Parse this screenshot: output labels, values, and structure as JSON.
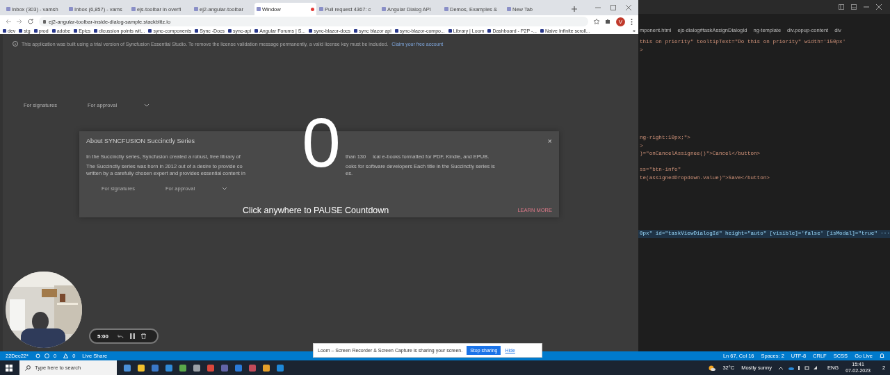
{
  "browser": {
    "tabs": [
      {
        "title": "Inbox (303) - vamsh",
        "selected": false,
        "recording": false
      },
      {
        "title": "Inbox (6,857) - vams",
        "selected": false,
        "recording": false
      },
      {
        "title": "ejs-toolbar in overfl",
        "selected": false,
        "recording": false
      },
      {
        "title": "ej2-angular-toolbar",
        "selected": false,
        "recording": false
      },
      {
        "title": "Window",
        "selected": true,
        "recording": true
      },
      {
        "title": "Pull request 4367: c",
        "selected": false,
        "recording": false
      },
      {
        "title": "Angular Dialog API",
        "selected": false,
        "recording": false
      },
      {
        "title": "Demos, Examples &",
        "selected": false,
        "recording": false
      },
      {
        "title": "New Tab",
        "selected": false,
        "recording": false
      }
    ],
    "address": "ej2-angular-toolbar-inside-dialog-sample.stackblitz.io",
    "profile_initial": "V",
    "bookmarks": [
      "dev",
      "stg",
      "prod",
      "adobe",
      "Epics",
      "dicussion points wit...",
      "sync-components",
      "Sync -Docs",
      "sync-api",
      "Angular Forums | S...",
      "sync-blazor-docs",
      "sync blazor api",
      "sync-blazor-compo...",
      "Library | Loom",
      "Dashboard - P2P -...",
      "Naive Infinite scroll..."
    ],
    "bookmarks_more": "»"
  },
  "page": {
    "license_notice": "This application was built using a trial version of Syncfusion Essential Studio. To remove the license validation message permanently, a valid license key must be included.",
    "license_link": "Claim your free account",
    "filters": [
      "For signatures",
      "For approval"
    ],
    "dialog": {
      "title": "About SYNCFUSION Succinctly Series",
      "close": "×",
      "lines": [
        [
          "In the Succinctly series, Syncfusion created a robust, free library of",
          "than 130",
          "ical e-books formatted for PDF, Kindle, and EPUB."
        ],
        [
          "The Succinctly series was born in 2012 out of a desire to provide co",
          "ooks for software developers Each title in the Succinctly series is"
        ],
        [
          "written by a carefully chosen expert and provides essential content in",
          "es."
        ]
      ],
      "filters": [
        "For signatures",
        "For approval"
      ],
      "action": "LEARN MORE"
    }
  },
  "recording_overlay": {
    "countdown": "0",
    "hint": "Click anywhere to PAUSE Countdown",
    "timer": "5:00"
  },
  "loom_bar": {
    "message": "Loom – Screen Recorder & Screen Capture is sharing your screen.",
    "button": "Stop sharing",
    "link": "Hide"
  },
  "editor": {
    "breadcrumbs": [
      "mponent.html",
      "ejs-dialog#taskAssignDialogId",
      "ng-template",
      "div.popup-content",
      "div"
    ],
    "lines": [
      {
        "kind": "code",
        "text": "this on priority\" tooltipText=\"Do this on priority\" width='150px'",
        "selected": false
      },
      {
        "kind": "code",
        "text": ">",
        "selected": false
      },
      {
        "kind": "blank",
        "selected": false
      },
      {
        "kind": "blank",
        "selected": false
      },
      {
        "kind": "blank",
        "selected": false
      },
      {
        "kind": "blank",
        "selected": false
      },
      {
        "kind": "blank",
        "selected": false
      },
      {
        "kind": "blank",
        "selected": false
      },
      {
        "kind": "blank",
        "selected": false
      },
      {
        "kind": "blank",
        "selected": false
      },
      {
        "kind": "blank",
        "selected": false
      },
      {
        "kind": "blank",
        "selected": false
      },
      {
        "kind": "code",
        "text": "ng-right:10px;\">",
        "selected": false
      },
      {
        "kind": "code",
        "text": ">",
        "selected": false
      },
      {
        "kind": "code",
        "text": ")=\"onCancelAssignee()\">Cancel</button>",
        "selected": false
      },
      {
        "kind": "blank",
        "selected": false
      },
      {
        "kind": "code",
        "text": "ss=\"btn-info\"",
        "selected": false
      },
      {
        "kind": "code",
        "text": "te(assignedDropdown.value)\">Save</button>",
        "selected": false
      },
      {
        "kind": "blank",
        "selected": false
      },
      {
        "kind": "blank",
        "selected": false
      },
      {
        "kind": "blank",
        "selected": false
      },
      {
        "kind": "blank",
        "selected": false
      },
      {
        "kind": "blank",
        "selected": false
      },
      {
        "kind": "blank",
        "selected": false
      },
      {
        "kind": "code",
        "text": "0px\" id=\"taskViewDialogId\" height=\"auto\" [visible]='false' [isModal]=\"true\" ···",
        "selected": true
      }
    ]
  },
  "status_bar": {
    "branch": "22Dec22*",
    "errors": "0",
    "warnings": "0",
    "live_share": "Live Share",
    "right": [
      "Ln 67, Col 16",
      "Spaces: 2",
      "UTF-8",
      "CRLF",
      "SCSS"
    ],
    "go_live": "Go Live"
  },
  "taskbar": {
    "search_placeholder": "Type here to search",
    "temperature": "32°C",
    "weather": "Mostly sunny",
    "language": "ENG",
    "time": "15:41",
    "date": "07-02-2023",
    "notifications": "2"
  }
}
